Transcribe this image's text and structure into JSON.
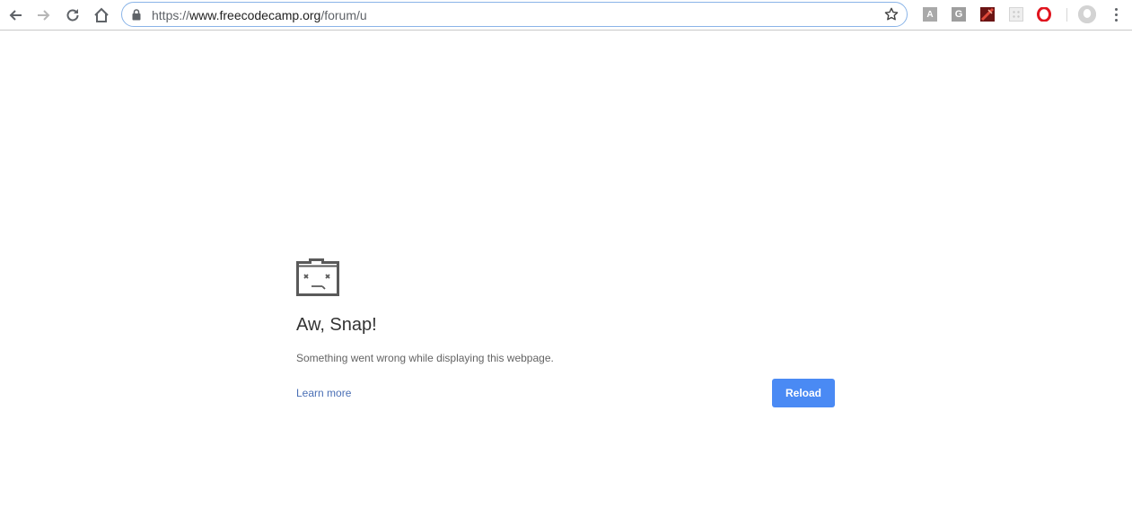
{
  "browser": {
    "omnibox": {
      "url_scheme": "https://",
      "url_host": "www.freecodecamp.org",
      "url_path": "/forum/u"
    },
    "extensions": {
      "ext_a_glyph": "A",
      "ext_g_glyph": "G"
    },
    "icons": [
      "back-arrow-icon",
      "forward-arrow-icon",
      "reload-icon",
      "home-icon",
      "lock-icon",
      "star-icon",
      "opera-icon",
      "profile-icon",
      "menu-icon"
    ]
  },
  "error_page": {
    "icon": "sad-tab-icon",
    "title": "Aw, Snap!",
    "message": "Something went wrong while displaying this webpage.",
    "learn_more_label": "Learn more",
    "reload_label": "Reload"
  },
  "colors": {
    "reload_button": "#4a8af4",
    "link": "#4a6fb5",
    "omnibox_focus_border": "#8ab4e8"
  }
}
